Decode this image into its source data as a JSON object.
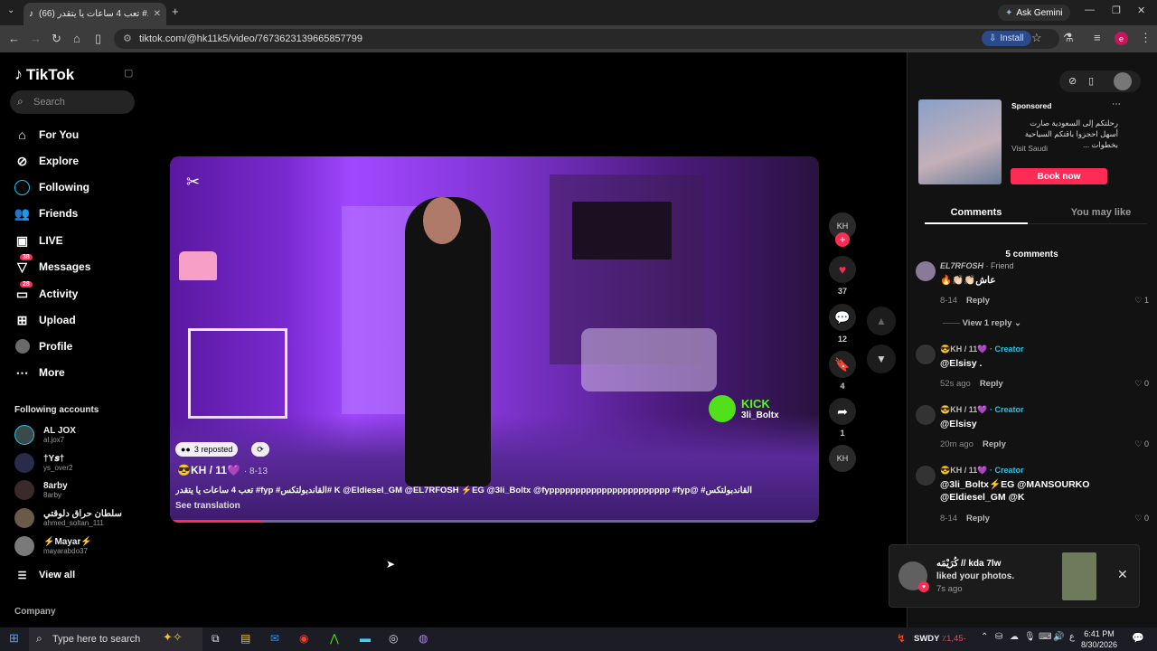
{
  "browser": {
    "tab_title": "(66) تعب 4 ساعات يا يتقدر #...",
    "url": "tiktok.com/@hk11k5/video/7673623139665857799",
    "install_label": "Install",
    "ask_gemini": "Ask Gemini",
    "profile_letter": "e"
  },
  "sidebar": {
    "logo": "TikTok",
    "search_placeholder": "Search",
    "nav": [
      {
        "label": "For You",
        "icon": "home-icon"
      },
      {
        "label": "Explore",
        "icon": "compass-icon"
      },
      {
        "label": "Following",
        "icon": "following-icon"
      },
      {
        "label": "Friends",
        "icon": "friends-icon"
      },
      {
        "label": "LIVE",
        "icon": "live-icon"
      },
      {
        "label": "Messages",
        "icon": "messages-icon",
        "badge": "38"
      },
      {
        "label": "Activity",
        "icon": "activity-icon",
        "badge": "28"
      },
      {
        "label": "Upload",
        "icon": "upload-icon"
      },
      {
        "label": "Profile",
        "icon": "profile-icon"
      },
      {
        "label": "More",
        "icon": "more-icon"
      }
    ],
    "following_title": "Following accounts",
    "accounts": [
      {
        "name": "AL JOX",
        "handle": "al.jox7"
      },
      {
        "name": "†Y𝒔†",
        "handle": "ys_over2"
      },
      {
        "name": "8arby",
        "handle": "8arby"
      },
      {
        "name": "سلطان حراق دلوقتي",
        "handle": "ahmed_soltan_111"
      },
      {
        "name": "⚡Mayar⚡",
        "handle": "mayarabdo37"
      }
    ],
    "view_all": "View all",
    "company": "Company"
  },
  "video": {
    "repost_label": "3 reposted",
    "author": "😎KH / 11💜",
    "date": "· 8-13",
    "caption": "القاندبولتكس# @K @Eldiesel_GM @EL7RFOSH ⚡EG @3li_Boltx @fyppppppppppppppppppppppp #fyp #القاندبولتكس# fyp# تعب 4 ساعات يا يتقدر",
    "see_translation": "See translation",
    "kick_brand": "KICK",
    "kick_user": "3li_Boltx",
    "progress": 0.14
  },
  "actions": {
    "likes": "37",
    "comments": "12",
    "saves": "4",
    "shares": "1"
  },
  "right_panel": {
    "ad": {
      "sponsored": "Sponsored",
      "desc": "رحلتكم إلى السعودية صارت أسهل احجزوا باقتكم السياحية بخطوات ...",
      "visit": "Visit Saudi",
      "book_now": "Book now"
    },
    "tab_comments": "Comments",
    "tab_may_like": "You may like",
    "comment_count": "5 comments",
    "comments": [
      {
        "user": "EL7RFOSH",
        "role": "· Friend",
        "text": "عاش👏🏻👏🏻🔥",
        "time": "8-14",
        "likes": "1"
      },
      {
        "user": "😎KH / 11💜",
        "role": "· Creator",
        "text": "@Elsisy .",
        "time": "52s ago",
        "likes": "0"
      },
      {
        "user": "😎KH / 11💜",
        "role": "· Creator",
        "text": "@Elsisy",
        "time": "20m ago",
        "likes": "0"
      },
      {
        "user": "😎KH / 11💜",
        "role": "· Creator",
        "text": "@3li_Boltx⚡EG @MANSOURKO @Eldiesel_GM @K",
        "time": "8-14",
        "likes": "0"
      }
    ],
    "view_reply": "View 1 reply",
    "reply_label": "Reply"
  },
  "notification": {
    "user": "كُرَيْمَه // kda 7lw",
    "text": "liked your photos.",
    "time": "7s ago"
  },
  "taskbar": {
    "search_placeholder": "Type here to search",
    "ticker_symbol": "SWDY",
    "ticker_change": "٪1,45-",
    "time": "6:41 PM",
    "date": "8/30/2026"
  }
}
